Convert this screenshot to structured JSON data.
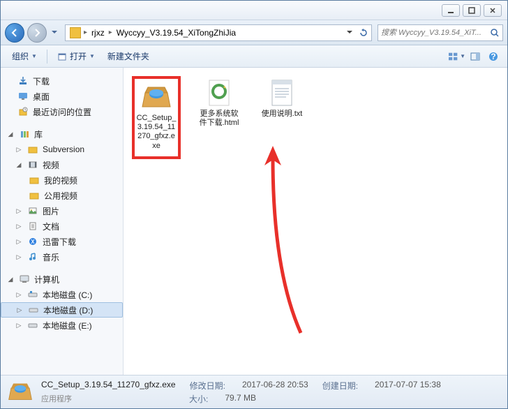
{
  "breadcrumb": {
    "item1": "rjxz",
    "item2": "Wyccyy_V3.19.54_XiTongZhiJia"
  },
  "search": {
    "placeholder": "搜索 Wyccyy_V3.19.54_XiT..."
  },
  "toolbar": {
    "organize": "组织",
    "open": "打开",
    "newfolder": "新建文件夹"
  },
  "sidebar": {
    "downloads": "下载",
    "desktop": "桌面",
    "recent": "最近访问的位置",
    "libraries": "库",
    "subversion": "Subversion",
    "videos": "视频",
    "myvideos": "我的视频",
    "publicvideos": "公用视频",
    "pictures": "图片",
    "documents": "文档",
    "xunlei": "迅雷下载",
    "music": "音乐",
    "computer": "计算机",
    "disk_c": "本地磁盘 (C:)",
    "disk_d": "本地磁盘 (D:)",
    "disk_e": "本地磁盘 (E:)"
  },
  "files": {
    "f1": "CC_Setup_3.19.54_11270_gfxz.exe",
    "f2": "更多系统软件下载.html",
    "f3": "使用说明.txt"
  },
  "status": {
    "filename": "CC_Setup_3.19.54_11270_gfxz.exe",
    "type": "应用程序",
    "mod_label": "修改日期:",
    "mod_value": "2017-06-28 20:53",
    "size_label": "大小:",
    "size_value": "79.7 MB",
    "create_label": "创建日期:",
    "create_value": "2017-07-07 15:38"
  }
}
